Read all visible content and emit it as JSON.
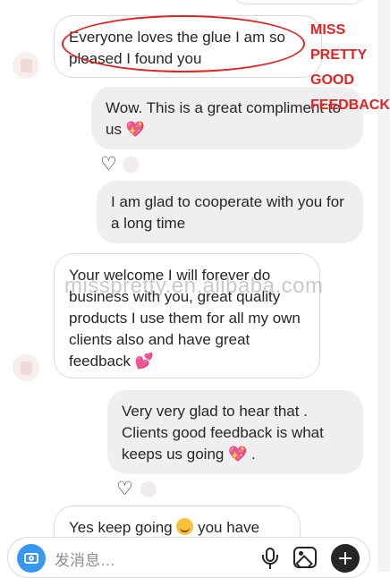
{
  "annotation": {
    "lines": [
      "MISS",
      "PRETTY",
      "GOOD",
      "FEEDBACK"
    ],
    "color": "#e02424"
  },
  "watermark": "misspretty.en.alibaba.com",
  "messages": [
    {
      "side": "in",
      "text": "Everyone loves the glue I am so pleased I found you"
    },
    {
      "side": "out",
      "text": "Wow. This is a great compliment to us",
      "emoji": "heart",
      "liked": true
    },
    {
      "side": "out",
      "text": "I am glad to cooperate with you for a long time"
    },
    {
      "side": "in",
      "text": "Your welcome I will forever do business with you, great quality products I use them for all my own clients also and have great feedback",
      "emoji": "heart"
    },
    {
      "side": "out",
      "text": "Very very glad to hear that . Clients good feedback is what keeps us going",
      "emoji": "heart",
      "suffix": " .",
      "liked": true
    },
    {
      "side": "in",
      "text": "Yes keep going",
      "emoji": "smile",
      "suffix": " you have"
    }
  ],
  "composer": {
    "placeholder": "发消息…",
    "icons": [
      "camera-icon",
      "microphone-icon",
      "gallery-icon",
      "add-icon"
    ],
    "accent": "#3897f0"
  }
}
